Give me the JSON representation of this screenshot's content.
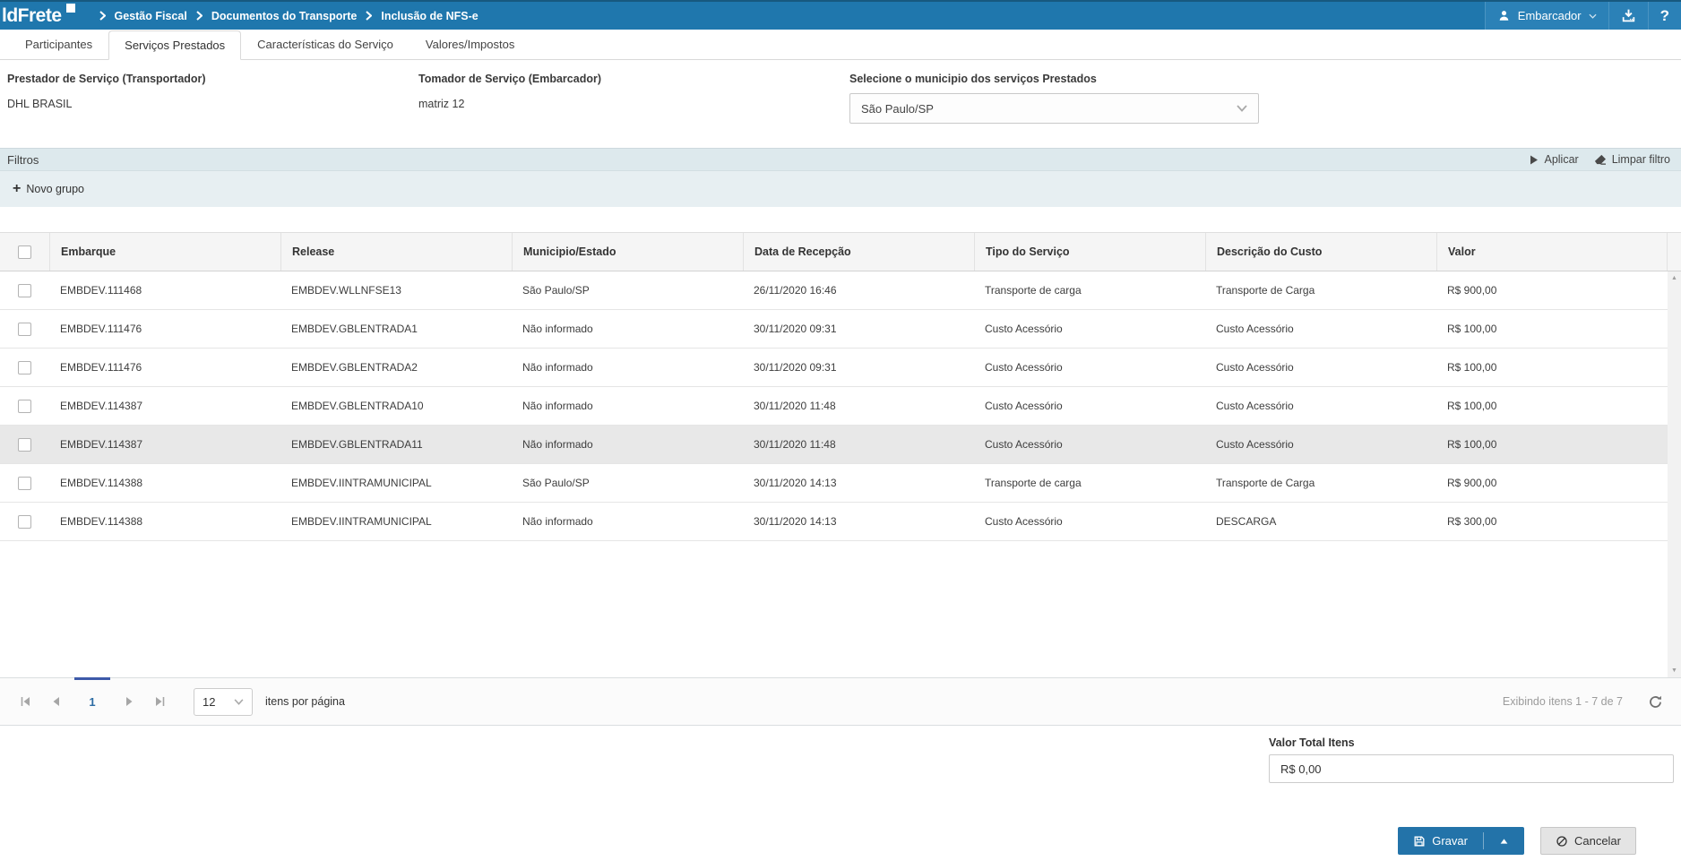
{
  "theme": {
    "topbar_blue": "#1f77ad",
    "topbar_section_blue": "#2b81b7",
    "accent_blue": "#2d6ca3",
    "pager_indicator_blue": "#3d5aa9",
    "filters_bar_bg": "#dde9ed",
    "filters_panel_bg": "#e7eff2",
    "row_highlight_gray": "#e8e8e8",
    "save_button_blue": "#2373a9"
  },
  "topbar": {
    "logo": "ldFrete",
    "breadcrumb": [
      "Gestão Fiscal",
      "Documentos do Transporte",
      "Inclusão de NFS-e"
    ],
    "user_label": "Embarcador",
    "help_glyph": "?"
  },
  "tabs": [
    {
      "label": "Participantes",
      "active": false
    },
    {
      "label": "Serviços Prestados",
      "active": true
    },
    {
      "label": "Características do Serviço",
      "active": false
    },
    {
      "label": "Valores/Impostos",
      "active": false
    }
  ],
  "form": {
    "prestador": {
      "label": "Prestador de Serviço (Transportador)",
      "value": "DHL BRASIL"
    },
    "tomador": {
      "label": "Tomador de Serviço (Embarcador)",
      "value": "matriz 12"
    },
    "municipio": {
      "label": "Selecione o municipio dos serviços Prestados",
      "value": "São Paulo/SP"
    }
  },
  "filters": {
    "title": "Filtros",
    "apply": "Aplicar",
    "clear": "Limpar filtro",
    "new_group": "Novo grupo",
    "plus_glyph": "+"
  },
  "table": {
    "columns": [
      "Embarque",
      "Release",
      "Municipio/Estado",
      "Data de Recepção",
      "Tipo do Serviço",
      "Descrição do Custo",
      "Valor"
    ],
    "rows": [
      {
        "embarque": "EMBDEV.111468",
        "release": "EMBDEV.WLLNFSE13",
        "municipio": "São Paulo/SP",
        "data_recepcao": "26/11/2020 16:46",
        "tipo_servico": "Transporte de carga",
        "descricao_custo": "Transporte de Carga",
        "valor": "R$ 900,00",
        "highlighted": false
      },
      {
        "embarque": "EMBDEV.111476",
        "release": "EMBDEV.GBLENTRADA1",
        "municipio": "Não informado",
        "data_recepcao": "30/11/2020 09:31",
        "tipo_servico": "Custo Acessório",
        "descricao_custo": "Custo Acessório",
        "valor": "R$ 100,00",
        "highlighted": false
      },
      {
        "embarque": "EMBDEV.111476",
        "release": "EMBDEV.GBLENTRADA2",
        "municipio": "Não informado",
        "data_recepcao": "30/11/2020 09:31",
        "tipo_servico": "Custo Acessório",
        "descricao_custo": "Custo Acessório",
        "valor": "R$ 100,00",
        "highlighted": false
      },
      {
        "embarque": "EMBDEV.114387",
        "release": "EMBDEV.GBLENTRADA10",
        "municipio": "Não informado",
        "data_recepcao": "30/11/2020 11:48",
        "tipo_servico": "Custo Acessório",
        "descricao_custo": "Custo Acessório",
        "valor": "R$ 100,00",
        "highlighted": false
      },
      {
        "embarque": "EMBDEV.114387",
        "release": "EMBDEV.GBLENTRADA11",
        "municipio": "Não informado",
        "data_recepcao": "30/11/2020 11:48",
        "tipo_servico": "Custo Acessório",
        "descricao_custo": "Custo Acessório",
        "valor": "R$ 100,00",
        "highlighted": true
      },
      {
        "embarque": "EMBDEV.114388",
        "release": "EMBDEV.IINTRAMUNICIPAL",
        "municipio": "São Paulo/SP",
        "data_recepcao": "30/11/2020 14:13",
        "tipo_servico": "Transporte de carga",
        "descricao_custo": "Transporte de Carga",
        "valor": "R$ 900,00",
        "highlighted": false
      },
      {
        "embarque": "EMBDEV.114388",
        "release": "EMBDEV.IINTRAMUNICIPAL",
        "municipio": "Não informado",
        "data_recepcao": "30/11/2020 14:13",
        "tipo_servico": "Custo Acessório",
        "descricao_custo": "DESCARGA",
        "valor": "R$ 300,00",
        "highlighted": false
      }
    ]
  },
  "pagination": {
    "current_page": "1",
    "page_size": "12",
    "items_per_page_label": "itens por página",
    "summary": "Exibindo itens 1 - 7 de 7"
  },
  "footer": {
    "total_label": "Valor Total Itens",
    "total_value": "R$ 0,00",
    "save_label": "Gravar",
    "cancel_label": "Cancelar"
  },
  "icons": {
    "user-icon": "person silhouette",
    "chevron-down-icon": "v chevron",
    "chevron-right-icon": "breadcrumb separator",
    "download-icon": "arrow into tray",
    "help-icon": "question mark",
    "apply-icon": "play triangle",
    "clear-filter-icon": "eraser",
    "plus-icon": "plus sign",
    "refresh-icon": "circular arrow",
    "save-icon": "floppy disk",
    "cancel-icon": "circle with slash",
    "pager-icons": "first / previous / next / last arrows",
    "scrollbar-arrows": "up and down triangles"
  }
}
